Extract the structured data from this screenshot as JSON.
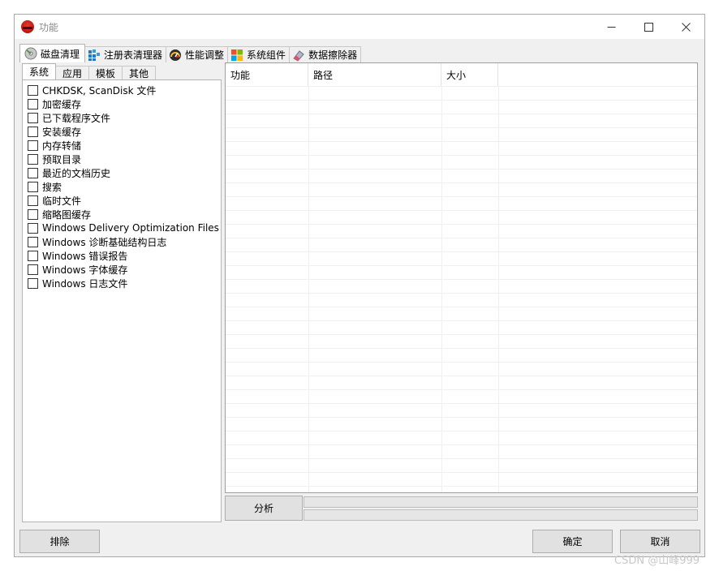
{
  "window": {
    "title": "功能",
    "controls": {
      "minimize": "—",
      "maximize": "☐",
      "close": "✕"
    }
  },
  "main_tabs": [
    {
      "label": "磁盘清理",
      "icon": "disk-cleanup-icon",
      "active": true
    },
    {
      "label": "注册表清理器",
      "icon": "registry-cleaner-icon",
      "active": false
    },
    {
      "label": "性能调整",
      "icon": "performance-gauge-icon",
      "active": false
    },
    {
      "label": "系统组件",
      "icon": "windows-components-icon",
      "active": false
    },
    {
      "label": "数据擦除器",
      "icon": "eraser-icon",
      "active": false
    }
  ],
  "sub_tabs": [
    {
      "label": "系统",
      "active": true
    },
    {
      "label": "应用",
      "active": false
    },
    {
      "label": "模板",
      "active": false
    },
    {
      "label": "其他",
      "active": false
    }
  ],
  "items": [
    {
      "label": "CHKDSK, ScanDisk 文件",
      "checked": false
    },
    {
      "label": "加密缓存",
      "checked": false
    },
    {
      "label": "已下载程序文件",
      "checked": false
    },
    {
      "label": "安装缓存",
      "checked": false
    },
    {
      "label": "内存转储",
      "checked": false
    },
    {
      "label": "预取目录",
      "checked": false
    },
    {
      "label": "最近的文档历史",
      "checked": false
    },
    {
      "label": "搜索",
      "checked": false
    },
    {
      "label": "临时文件",
      "checked": false
    },
    {
      "label": "缩略图缓存",
      "checked": false
    },
    {
      "label": "Windows Delivery Optimization Files",
      "checked": false
    },
    {
      "label": "Windows 诊断基础结构日志",
      "checked": false
    },
    {
      "label": "Windows 错误报告",
      "checked": false
    },
    {
      "label": "Windows 字体缓存",
      "checked": false
    },
    {
      "label": "Windows 日志文件",
      "checked": false
    }
  ],
  "table": {
    "columns": [
      "功能",
      "路径",
      "大小"
    ],
    "rows": []
  },
  "buttons": {
    "analyze": "分析",
    "exclude": "排除",
    "ok": "确定",
    "cancel": "取消"
  },
  "progress": [
    0,
    0
  ],
  "watermark": "CSDN @山峰999"
}
